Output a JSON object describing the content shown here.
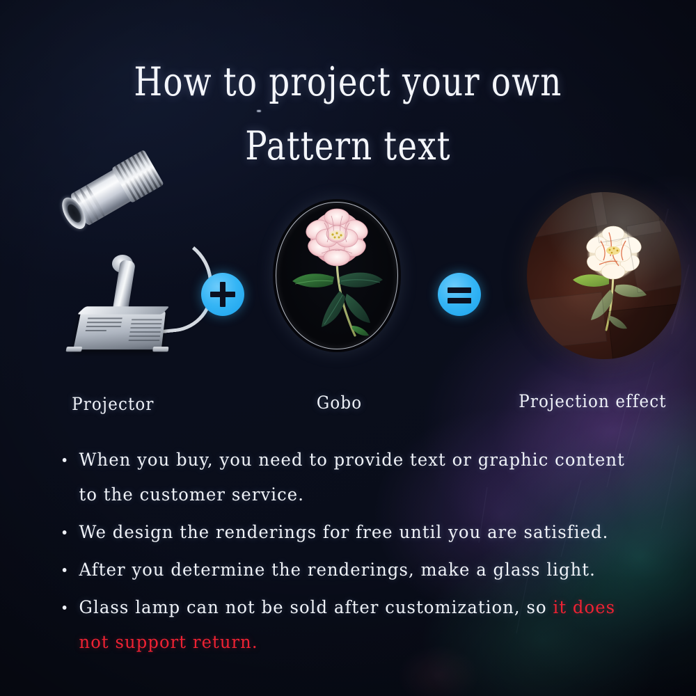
{
  "title": {
    "line1": "How to project your own",
    "line2": "Pattern text"
  },
  "items": [
    {
      "label": "Projector",
      "icon": "led-projector-lamp"
    },
    {
      "label": "Gobo",
      "icon": "gobo-glass-disc-pink-peony"
    },
    {
      "label": "Projection effect",
      "icon": "projected-flower-on-wall"
    }
  ],
  "operators": [
    {
      "name": "plus",
      "symbol": "+",
      "color": "#35b5f5"
    },
    {
      "name": "equals",
      "symbol": "=",
      "color": "#35b5f5"
    }
  ],
  "bullets": [
    {
      "text": "When you buy, you need to provide text or graphic content to the customer service.",
      "highlight": ""
    },
    {
      "text": "We design the renderings for free until you are satisfied.",
      "highlight": ""
    },
    {
      "text": "After you determine the renderings, make a glass light.",
      "highlight": ""
    },
    {
      "text": "Glass lamp can not be sold after customization, so ",
      "highlight": "it does not support return."
    }
  ],
  "colors": {
    "background": "#0b1020",
    "text": "#f0f3f8",
    "accent": "#35b5f5",
    "warning": "#ee2233"
  }
}
